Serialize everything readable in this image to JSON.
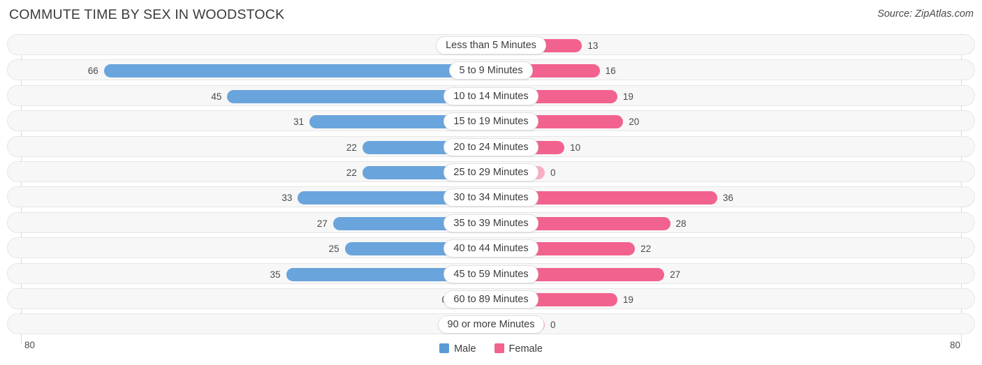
{
  "header": {
    "title": "COMMUTE TIME BY SEX IN WOODSTOCK",
    "source": "Source: ZipAtlas.com"
  },
  "axis": {
    "left_end_label": "80",
    "right_end_label": "80",
    "max": 80
  },
  "legend": {
    "items": [
      {
        "label": "Male",
        "color": "#5b9bd5"
      },
      {
        "label": "Female",
        "color": "#f0648e"
      }
    ]
  },
  "colors": {
    "male_strong": "#6aa4dc",
    "male_light": "#aecbef",
    "female_strong": "#f2628f",
    "female_light": "#f9aec4",
    "track": "#f7f7f7",
    "track_border": "#e6e6e6"
  },
  "chart_data": {
    "type": "bar",
    "title": "COMMUTE TIME BY SEX IN WOODSTOCK",
    "xlabel": "",
    "ylabel": "",
    "orientation": "horizontal-diverging",
    "xlim": [
      0,
      80
    ],
    "grid": false,
    "legend_position": "bottom-center",
    "categories": [
      "Less than 5 Minutes",
      "5 to 9 Minutes",
      "10 to 14 Minutes",
      "15 to 19 Minutes",
      "20 to 24 Minutes",
      "25 to 29 Minutes",
      "30 to 34 Minutes",
      "35 to 39 Minutes",
      "40 to 44 Minutes",
      "45 to 59 Minutes",
      "60 to 89 Minutes",
      "90 or more Minutes"
    ],
    "series": [
      {
        "name": "Male",
        "direction": "left",
        "values": [
          0,
          66,
          45,
          31,
          22,
          22,
          33,
          27,
          25,
          35,
          0,
          0
        ]
      },
      {
        "name": "Female",
        "direction": "right",
        "values": [
          13,
          16,
          19,
          20,
          10,
          0,
          36,
          28,
          22,
          27,
          19,
          0
        ]
      }
    ]
  }
}
